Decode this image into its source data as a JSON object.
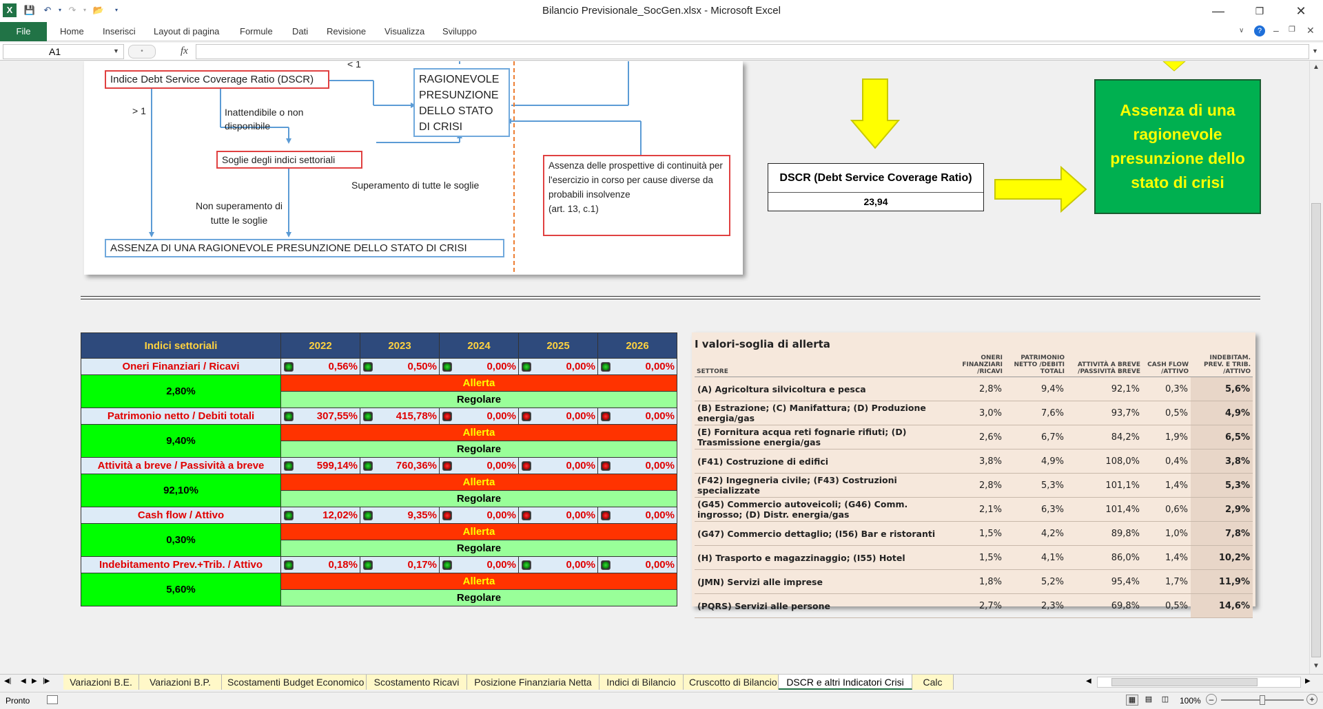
{
  "window": {
    "title": "Bilancio Previsionale_SocGen.xlsx - Microsoft Excel"
  },
  "ribbon": {
    "file_label": "File",
    "tabs": [
      "Home",
      "Inserisci",
      "Layout di pagina",
      "Formule",
      "Dati",
      "Revisione",
      "Visualizza",
      "Sviluppo"
    ]
  },
  "formula_bar": {
    "name_box": "A1",
    "fx": "fx",
    "formula": ""
  },
  "flowchart": {
    "dscr_label": "Indice Debt Service Coverage Ratio (DSCR)",
    "lt1": "< 1",
    "gt1": "> 1",
    "inattendibile": "Inattendibile o non disponibile",
    "ragionevole": "RAGIONEVOLE PRESUNZIONE DELLO STATO DI CRISI",
    "soglie": "Soglie degli indici settoriali",
    "superamento": "Superamento di tutte le soglie",
    "non_superamento": "Non superamento di tutte le soglie",
    "assenza_prosp": "Assenza delle prospettive di continuità per l'esercizio in corso per cause diverse da probabili insolvenze",
    "art": "(art. 13, c.1)",
    "assenza_main": "ASSENZA DI UNA RAGIONEVOLE PRESUNZIONE  DELLO STATO DI CRISI"
  },
  "dscr": {
    "label": "DSCR (Debt Service Coverage Ratio)",
    "value": "23,94"
  },
  "result_box": {
    "text": "Assenza di una ragionevole presunzione dello stato di crisi"
  },
  "indici": {
    "title": "Indici settoriali",
    "years": [
      "2022",
      "2023",
      "2024",
      "2025",
      "2026"
    ],
    "allerta": "Allerta",
    "regolare": "Regolare",
    "rows": [
      {
        "name": "Oneri Finanziari / Ricavi",
        "threshold": "2,80%",
        "values": [
          "0,56%",
          "0,50%",
          "0,00%",
          "0,00%",
          "0,00%"
        ],
        "lights": [
          "green",
          "green",
          "green",
          "green",
          "green"
        ]
      },
      {
        "name": "Patrimonio netto / Debiti totali",
        "threshold": "9,40%",
        "values": [
          "307,55%",
          "415,78%",
          "0,00%",
          "0,00%",
          "0,00%"
        ],
        "lights": [
          "green",
          "green",
          "red",
          "red",
          "red"
        ]
      },
      {
        "name": "Attività a breve / Passività a breve",
        "threshold": "92,10%",
        "values": [
          "599,14%",
          "760,36%",
          "0,00%",
          "0,00%",
          "0,00%"
        ],
        "lights": [
          "green",
          "green",
          "red",
          "red",
          "red"
        ]
      },
      {
        "name": "Cash flow / Attivo",
        "threshold": "0,30%",
        "values": [
          "12,02%",
          "9,35%",
          "0,00%",
          "0,00%",
          "0,00%"
        ],
        "lights": [
          "green",
          "green",
          "red",
          "red",
          "red"
        ]
      },
      {
        "name": "Indebitamento Prev.+Trib. / Attivo",
        "threshold": "5,60%",
        "values": [
          "0,18%",
          "0,17%",
          "0,00%",
          "0,00%",
          "0,00%"
        ],
        "lights": [
          "green",
          "green",
          "green",
          "green",
          "green"
        ]
      }
    ]
  },
  "soglie": {
    "title": "I valori-soglia di allerta",
    "headers": [
      "SETTORE",
      "ONERI FINANZIARI /RICAVI",
      "PATRIMONIO NETTO /DEBITI TOTALI",
      "ATTIVITÀ A BREVE /PASSIVITÀ BREVE",
      "CASH FLOW /ATTIVO",
      "INDEBITAM. PREV. E TRIB. /ATTIVO"
    ],
    "rows": [
      {
        "s": "(A) Agricoltura silvicoltura e pesca",
        "v": [
          "2,8%",
          "9,4%",
          "92,1%",
          "0,3%",
          "5,6%"
        ]
      },
      {
        "s": "(B) Estrazione; (C) Manifattura; (D) Produzione energia/gas",
        "v": [
          "3,0%",
          "7,6%",
          "93,7%",
          "0,5%",
          "4,9%"
        ]
      },
      {
        "s": "(E) Fornitura acqua reti fognarie rifiuti; (D) Trasmissione energia/gas",
        "v": [
          "2,6%",
          "6,7%",
          "84,2%",
          "1,9%",
          "6,5%"
        ]
      },
      {
        "s": "(F41) Costruzione di edifici",
        "v": [
          "3,8%",
          "4,9%",
          "108,0%",
          "0,4%",
          "3,8%"
        ]
      },
      {
        "s": "(F42) Ingegneria civile; (F43) Costruzioni specializzate",
        "v": [
          "2,8%",
          "5,3%",
          "101,1%",
          "1,4%",
          "5,3%"
        ]
      },
      {
        "s": "(G45) Commercio autoveicoli; (G46) Comm. ingrosso; (D) Distr. energia/gas",
        "v": [
          "2,1%",
          "6,3%",
          "101,4%",
          "0,6%",
          "2,9%"
        ]
      },
      {
        "s": "(G47) Commercio dettaglio; (I56) Bar e ristoranti",
        "v": [
          "1,5%",
          "4,2%",
          "89,8%",
          "1,0%",
          "7,8%"
        ]
      },
      {
        "s": "(H) Trasporto e magazzinaggio; (I55) Hotel",
        "v": [
          "1,5%",
          "4,1%",
          "86,0%",
          "1,4%",
          "10,2%"
        ]
      },
      {
        "s": "(JMN) Servizi alle imprese",
        "v": [
          "1,8%",
          "5,2%",
          "95,4%",
          "1,7%",
          "11,9%"
        ]
      },
      {
        "s": "(PQRS) Servizi alle persone",
        "v": [
          "2,7%",
          "2,3%",
          "69,8%",
          "0,5%",
          "14,6%"
        ]
      }
    ]
  },
  "sheet_tabs": [
    "Variazioni B.E.",
    "Variazioni B.P.",
    "Scostamenti Budget Economico",
    "Scostamento Ricavi",
    "Posizione Finanziaria Netta",
    "Indici di Bilancio",
    "Cruscotto di Bilancio",
    "DSCR e altri Indicatori Crisi",
    "Calc"
  ],
  "active_tab": "DSCR e altri Indicatori Crisi",
  "status": {
    "ready": "Pronto",
    "zoom": "100%"
  },
  "colors": {
    "excel_green": "#217346",
    "header_blue": "#2e4a7c",
    "alert_red": "#ff3300",
    "ok_green": "#00ff00"
  }
}
